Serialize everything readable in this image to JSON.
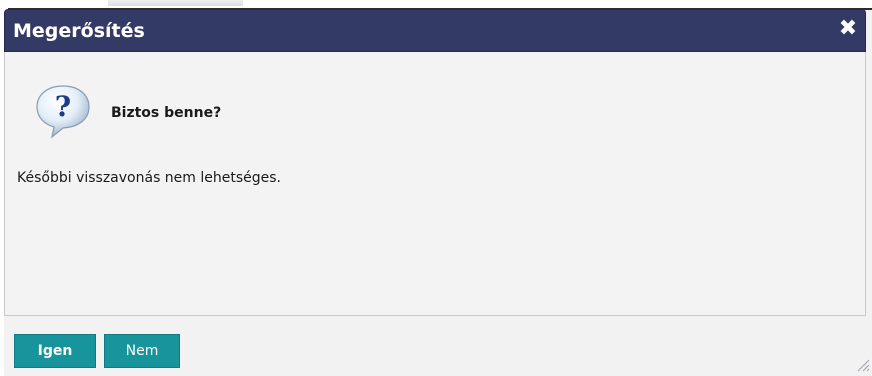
{
  "dialog": {
    "title": "Megerősítés",
    "close_glyph": "✖",
    "icon": "question-speech-bubble-icon",
    "heading": "Biztos benne?",
    "message": "Későbbi visszavonás nem lehetséges.",
    "buttons": {
      "yes_label": "Igen",
      "no_label": "Nem"
    }
  },
  "colors": {
    "titlebar": "#343a66",
    "button": "#17949c",
    "body": "#f3f3f3"
  }
}
